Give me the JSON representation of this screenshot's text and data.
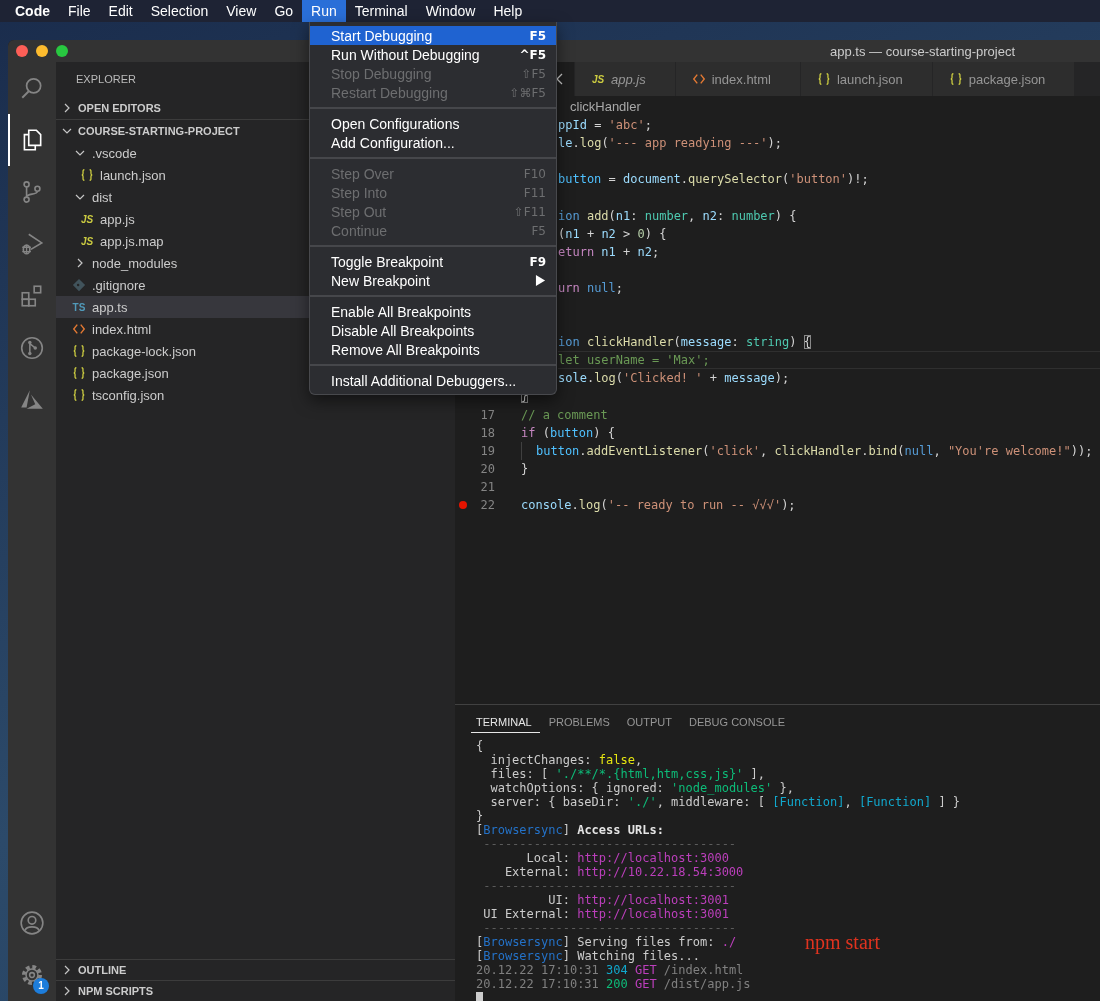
{
  "menu_bar": {
    "items": [
      {
        "label": "Code",
        "kind": "app",
        "selected": false
      },
      {
        "label": "File",
        "kind": "menu",
        "selected": false
      },
      {
        "label": "Edit",
        "kind": "menu",
        "selected": false
      },
      {
        "label": "Selection",
        "kind": "menu",
        "selected": false
      },
      {
        "label": "View",
        "kind": "menu",
        "selected": false
      },
      {
        "label": "Go",
        "kind": "menu",
        "selected": false
      },
      {
        "label": "Run",
        "kind": "menu",
        "selected": true
      },
      {
        "label": "Terminal",
        "kind": "menu",
        "selected": false
      },
      {
        "label": "Window",
        "kind": "menu",
        "selected": false
      },
      {
        "label": "Help",
        "kind": "menu",
        "selected": false
      }
    ]
  },
  "run_menu": {
    "groups": [
      [
        {
          "label": "Start Debugging",
          "shortcut": "F5",
          "disabled": false,
          "selected": true,
          "submenu": false
        },
        {
          "label": "Run Without Debugging",
          "shortcut": "^F5",
          "disabled": false,
          "selected": false,
          "submenu": false
        },
        {
          "label": "Stop Debugging",
          "shortcut": "⇧F5",
          "disabled": true,
          "selected": false,
          "submenu": false
        },
        {
          "label": "Restart Debugging",
          "shortcut": "⇧⌘F5",
          "disabled": true,
          "selected": false,
          "submenu": false
        }
      ],
      [
        {
          "label": "Open Configurations",
          "disabled": false,
          "selected": false,
          "submenu": false
        },
        {
          "label": "Add Configuration...",
          "disabled": false,
          "selected": false,
          "submenu": false
        }
      ],
      [
        {
          "label": "Step Over",
          "shortcut": "F10",
          "disabled": true,
          "selected": false,
          "submenu": false
        },
        {
          "label": "Step Into",
          "shortcut": "F11",
          "disabled": true,
          "selected": false,
          "submenu": false
        },
        {
          "label": "Step Out",
          "shortcut": "⇧F11",
          "disabled": true,
          "selected": false,
          "submenu": false
        },
        {
          "label": "Continue",
          "shortcut": "F5",
          "disabled": true,
          "selected": false,
          "submenu": false
        }
      ],
      [
        {
          "label": "Toggle Breakpoint",
          "shortcut": "F9",
          "disabled": false,
          "selected": false,
          "submenu": false
        },
        {
          "label": "New Breakpoint",
          "disabled": false,
          "selected": false,
          "submenu": true
        }
      ],
      [
        {
          "label": "Enable All Breakpoints",
          "disabled": false,
          "selected": false,
          "submenu": false
        },
        {
          "label": "Disable All Breakpoints",
          "disabled": false,
          "selected": false,
          "submenu": false
        },
        {
          "label": "Remove All Breakpoints",
          "disabled": false,
          "selected": false,
          "submenu": false
        }
      ],
      [
        {
          "label": "Install Additional Debuggers...",
          "disabled": false,
          "selected": false,
          "submenu": false
        }
      ]
    ]
  },
  "window": {
    "title": "app.ts — course-starting-project"
  },
  "activity_bar": {
    "items": [
      {
        "kind": "search",
        "selected": false
      },
      {
        "kind": "explorer",
        "selected": true
      },
      {
        "kind": "source-control",
        "selected": false
      },
      {
        "kind": "run",
        "selected": false
      },
      {
        "kind": "extensions",
        "selected": false
      },
      {
        "kind": "git-graph",
        "selected": false
      },
      {
        "kind": "azure",
        "selected": false
      }
    ],
    "bottom": [
      {
        "kind": "account"
      },
      {
        "kind": "settings",
        "badge": "1"
      }
    ]
  },
  "sidebar": {
    "title": "EXPLORER",
    "sections": [
      {
        "title": "OPEN EDITORS",
        "expanded": false
      },
      {
        "title": "COURSE-STARTING-PROJECT",
        "expanded": true,
        "children": [
          {
            "name": ".vscode",
            "kind": "folder",
            "expanded": true,
            "selected": false,
            "children": [
              {
                "name": "launch.json",
                "kind": "json",
                "selected": false
              }
            ]
          },
          {
            "name": "dist",
            "kind": "folder",
            "expanded": true,
            "selected": false,
            "children": [
              {
                "name": "app.js",
                "kind": "script",
                "icon_text": "JS",
                "selected": false
              },
              {
                "name": "app.js.map",
                "kind": "script",
                "icon_text": "JS",
                "selected": false
              }
            ]
          },
          {
            "name": "node_modules",
            "kind": "folder",
            "expanded": false,
            "selected": false
          },
          {
            "name": ".gitignore",
            "kind": "git",
            "selected": false
          },
          {
            "name": "app.ts",
            "kind": "typescript",
            "icon_text": "TS",
            "selected": true
          },
          {
            "name": "index.html",
            "kind": "html",
            "selected": false
          },
          {
            "name": "package-lock.json",
            "kind": "json",
            "selected": false
          },
          {
            "name": "package.json",
            "kind": "json",
            "selected": false
          },
          {
            "name": "tsconfig.json",
            "kind": "json",
            "selected": false
          }
        ]
      }
    ],
    "bottom_sections": [
      {
        "title": "OUTLINE",
        "expanded": false
      },
      {
        "title": "NPM SCRIPTS",
        "expanded": false
      }
    ]
  },
  "editor": {
    "tabs": [
      {
        "kind": "hidden",
        "selected": true,
        "preview": false
      },
      {
        "label": "app.js",
        "kind": "script",
        "icon_text": "JS",
        "selected": false,
        "preview": true
      },
      {
        "label": "index.html",
        "kind": "html",
        "selected": false,
        "preview": false
      },
      {
        "label": "launch.json",
        "kind": "json",
        "selected": false,
        "preview": false
      },
      {
        "label": "package.json",
        "kind": "json",
        "selected": false,
        "preview": false
      }
    ],
    "breadcrumb": {
      "symbol": "clickHandler"
    },
    "lines": [
      {
        "kind": "clipped",
        "current": false,
        "breakpoint": false,
        "indent_guide": false,
        "tokens": [
          {
            "kind": "var",
            "text": "ppId"
          },
          {
            "kind": "plain",
            "text": " = "
          },
          {
            "kind": "str",
            "text": "'abc'"
          },
          {
            "kind": "plain",
            "text": ";"
          }
        ]
      },
      {
        "kind": "clipped",
        "current": false,
        "breakpoint": false,
        "indent_guide": false,
        "tokens": [
          {
            "kind": "var",
            "text": "le"
          },
          {
            "kind": "plain",
            "text": "."
          },
          {
            "kind": "fn",
            "text": "log"
          },
          {
            "kind": "plain",
            "text": "("
          },
          {
            "kind": "str",
            "text": "'--- app readying ---'"
          },
          {
            "kind": "plain",
            "text": ");"
          }
        ]
      },
      {
        "kind": "clipped"
      },
      {
        "kind": "clipped",
        "current": false,
        "breakpoint": false,
        "indent_guide": false,
        "tokens": [
          {
            "kind": "const",
            "text": "button"
          },
          {
            "kind": "plain",
            "text": " = "
          },
          {
            "kind": "var",
            "text": "document"
          },
          {
            "kind": "plain",
            "text": "."
          },
          {
            "kind": "fn",
            "text": "querySelector"
          },
          {
            "kind": "plain",
            "text": "("
          },
          {
            "kind": "str",
            "text": "'button'"
          },
          {
            "kind": "plain",
            "text": ")!;"
          }
        ]
      },
      {
        "kind": "clipped"
      },
      {
        "kind": "clipped",
        "current": false,
        "breakpoint": false,
        "indent_guide": false,
        "tokens": [
          {
            "kind": "kw",
            "text": "ion "
          },
          {
            "kind": "fn",
            "text": "add"
          },
          {
            "kind": "plain",
            "text": "("
          },
          {
            "kind": "var",
            "text": "n1"
          },
          {
            "kind": "plain",
            "text": ": "
          },
          {
            "kind": "type",
            "text": "number"
          },
          {
            "kind": "plain",
            "text": ", "
          },
          {
            "kind": "var",
            "text": "n2"
          },
          {
            "kind": "plain",
            "text": ": "
          },
          {
            "kind": "type",
            "text": "number"
          },
          {
            "kind": "plain",
            "text": ") {"
          }
        ]
      },
      {
        "kind": "clipped",
        "current": false,
        "breakpoint": false,
        "indent_guide": false,
        "tokens": [
          {
            "kind": "plain",
            "text": "("
          },
          {
            "kind": "var",
            "text": "n1"
          },
          {
            "kind": "plain",
            "text": " + "
          },
          {
            "kind": "var",
            "text": "n2"
          },
          {
            "kind": "plain",
            "text": " > "
          },
          {
            "kind": "num",
            "text": "0"
          },
          {
            "kind": "plain",
            "text": ") {"
          }
        ]
      },
      {
        "kind": "clipped",
        "current": false,
        "breakpoint": false,
        "indent_guide": false,
        "tokens": [
          {
            "kind": "ctl",
            "text": "eturn "
          },
          {
            "kind": "var",
            "text": "n1"
          },
          {
            "kind": "plain",
            "text": " + "
          },
          {
            "kind": "var",
            "text": "n2"
          },
          {
            "kind": "plain",
            "text": ";"
          }
        ]
      },
      {
        "kind": "clipped"
      },
      {
        "kind": "clipped",
        "current": false,
        "breakpoint": false,
        "indent_guide": false,
        "tokens": [
          {
            "kind": "ctl",
            "text": "urn "
          },
          {
            "kind": "kw",
            "text": "null"
          },
          {
            "kind": "plain",
            "text": ";"
          }
        ]
      },
      {
        "kind": "clipped"
      },
      {
        "kind": "clipped"
      },
      {
        "kind": "clipped",
        "current": false,
        "breakpoint": false,
        "indent_guide": false,
        "tokens": [
          {
            "kind": "kw",
            "text": "ion "
          },
          {
            "kind": "fn",
            "text": "clickHandler"
          },
          {
            "kind": "plain",
            "text": "("
          },
          {
            "kind": "var",
            "text": "message"
          },
          {
            "kind": "plain",
            "text": ": "
          },
          {
            "kind": "type",
            "text": "string"
          },
          {
            "kind": "plain",
            "text": ") "
          },
          {
            "kind": "bracket",
            "text": "{"
          }
        ]
      },
      {
        "kind": "clipped",
        "current": true,
        "breakpoint": false,
        "indent_guide": false,
        "tokens": [
          {
            "kind": "com",
            "text": "let userName = 'Max';"
          }
        ]
      },
      {
        "kind": "clipped",
        "current": false,
        "breakpoint": false,
        "indent_guide": false,
        "tokens": [
          {
            "kind": "var",
            "text": "sole"
          },
          {
            "kind": "plain",
            "text": "."
          },
          {
            "kind": "fn",
            "text": "log"
          },
          {
            "kind": "plain",
            "text": "("
          },
          {
            "kind": "str",
            "text": "'Clicked! '"
          },
          {
            "kind": "plain",
            "text": " + "
          },
          {
            "kind": "var",
            "text": "message"
          },
          {
            "kind": "plain",
            "text": ");"
          }
        ]
      },
      {
        "kind": "full",
        "current": false,
        "breakpoint": false,
        "indent_guide": false,
        "tokens": [
          {
            "kind": "bracket",
            "text": "}"
          }
        ]
      },
      {
        "kind": "full",
        "number": "17",
        "current": false,
        "breakpoint": false,
        "indent_guide": false,
        "tokens": [
          {
            "kind": "com",
            "text": "// a comment"
          }
        ]
      },
      {
        "kind": "full",
        "number": "18",
        "current": false,
        "breakpoint": false,
        "indent_guide": false,
        "tokens": [
          {
            "kind": "ctl",
            "text": "if"
          },
          {
            "kind": "plain",
            "text": " ("
          },
          {
            "kind": "const",
            "text": "button"
          },
          {
            "kind": "plain",
            "text": ") {"
          }
        ]
      },
      {
        "kind": "full",
        "number": "19",
        "current": false,
        "breakpoint": false,
        "indent_guide": true,
        "tokens": [
          {
            "kind": "const",
            "text": "button"
          },
          {
            "kind": "plain",
            "text": "."
          },
          {
            "kind": "fn",
            "text": "addEventListener"
          },
          {
            "kind": "plain",
            "text": "("
          },
          {
            "kind": "str",
            "text": "'click'"
          },
          {
            "kind": "plain",
            "text": ", "
          },
          {
            "kind": "fn",
            "text": "clickHandler"
          },
          {
            "kind": "plain",
            "text": "."
          },
          {
            "kind": "fn",
            "text": "bind"
          },
          {
            "kind": "plain",
            "text": "("
          },
          {
            "kind": "kw",
            "text": "null"
          },
          {
            "kind": "plain",
            "text": ", "
          },
          {
            "kind": "str",
            "text": "\"You're welcome!\""
          },
          {
            "kind": "plain",
            "text": "));"
          }
        ]
      },
      {
        "kind": "full",
        "number": "20",
        "current": false,
        "breakpoint": false,
        "indent_guide": false,
        "tokens": [
          {
            "kind": "plain",
            "text": "}"
          }
        ]
      },
      {
        "kind": "full",
        "number": "21",
        "current": false,
        "breakpoint": false,
        "indent_guide": false
      },
      {
        "kind": "full",
        "number": "22",
        "current": false,
        "breakpoint": true,
        "indent_guide": false,
        "tokens": [
          {
            "kind": "var",
            "text": "console"
          },
          {
            "kind": "plain",
            "text": "."
          },
          {
            "kind": "fn",
            "text": "log"
          },
          {
            "kind": "plain",
            "text": "("
          },
          {
            "kind": "str",
            "text": "'-- ready to run -- √√√'"
          },
          {
            "kind": "plain",
            "text": ");"
          }
        ]
      }
    ]
  },
  "panel": {
    "tabs": [
      {
        "label": "TERMINAL",
        "selected": true
      },
      {
        "label": "PROBLEMS",
        "selected": false
      },
      {
        "label": "OUTPUT",
        "selected": false
      },
      {
        "label": "DEBUG CONSOLE",
        "selected": false
      }
    ],
    "terminal": {
      "cursor": true,
      "lines": [
        {
          "kind": "text",
          "tokens": [
            {
              "kind": "plain",
              "text": "{"
            }
          ]
        },
        {
          "kind": "text",
          "tokens": [
            {
              "kind": "plain",
              "text": "  injectChanges: "
            },
            {
              "kind": "bool",
              "text": "false"
            },
            {
              "kind": "plain",
              "text": ","
            }
          ]
        },
        {
          "kind": "text",
          "tokens": [
            {
              "kind": "plain",
              "text": "  files: [ "
            },
            {
              "kind": "str",
              "text": "'./**/*.{html,htm,css,js}'"
            },
            {
              "kind": "plain",
              "text": " ],"
            }
          ]
        },
        {
          "kind": "text",
          "tokens": [
            {
              "kind": "plain",
              "text": "  watchOptions: { ignored: "
            },
            {
              "kind": "str",
              "text": "'node_modules'"
            },
            {
              "kind": "plain",
              "text": " },"
            }
          ]
        },
        {
          "kind": "text",
          "tokens": [
            {
              "kind": "plain",
              "text": "  server: { baseDir: "
            },
            {
              "kind": "str",
              "text": "'./'"
            },
            {
              "kind": "plain",
              "text": ", middleware: [ "
            },
            {
              "kind": "fn",
              "text": "[Function]"
            },
            {
              "kind": "plain",
              "text": ", "
            },
            {
              "kind": "fn",
              "text": "[Function]"
            },
            {
              "kind": "plain",
              "text": " ] }"
            }
          ]
        },
        {
          "kind": "text",
          "tokens": [
            {
              "kind": "plain",
              "text": "}"
            }
          ]
        },
        {
          "kind": "text",
          "tokens": [
            {
              "kind": "plain",
              "text": "["
            },
            {
              "kind": "tag",
              "text": "Browsersync"
            },
            {
              "kind": "plain",
              "text": "] "
            },
            {
              "kind": "bold",
              "text": "Access URLs:"
            }
          ]
        },
        {
          "kind": "rule",
          "tokens": [
            {
              "kind": "rule",
              "text": " -----------------------------------"
            }
          ]
        },
        {
          "kind": "text",
          "tokens": [
            {
              "kind": "plain",
              "text": "       Local: "
            },
            {
              "kind": "url",
              "text": "http://localhost:3000"
            }
          ]
        },
        {
          "kind": "text",
          "tokens": [
            {
              "kind": "plain",
              "text": "    External: "
            },
            {
              "kind": "url",
              "text": "http://10.22.18.54:3000"
            }
          ]
        },
        {
          "kind": "rule",
          "tokens": [
            {
              "kind": "rule",
              "text": " -----------------------------------"
            }
          ]
        },
        {
          "kind": "text",
          "tokens": [
            {
              "kind": "plain",
              "text": "          UI: "
            },
            {
              "kind": "url",
              "text": "http://localhost:3001"
            }
          ]
        },
        {
          "kind": "text",
          "tokens": [
            {
              "kind": "plain",
              "text": " UI External: "
            },
            {
              "kind": "url",
              "text": "http://localhost:3001"
            }
          ]
        },
        {
          "kind": "rule",
          "tokens": [
            {
              "kind": "rule",
              "text": " -----------------------------------"
            }
          ]
        },
        {
          "kind": "text",
          "tokens": [
            {
              "kind": "plain",
              "text": "["
            },
            {
              "kind": "tag",
              "text": "Browsersync"
            },
            {
              "kind": "plain",
              "text": "] Serving files from: "
            },
            {
              "kind": "url",
              "text": "./"
            }
          ]
        },
        {
          "kind": "text",
          "tokens": [
            {
              "kind": "plain",
              "text": "["
            },
            {
              "kind": "tag",
              "text": "Browsersync"
            },
            {
              "kind": "plain",
              "text": "] Watching files..."
            }
          ]
        },
        {
          "kind": "text",
          "tokens": [
            {
              "kind": "dim",
              "text": "20.12.22 17:10:31 "
            },
            {
              "kind": "info",
              "text": "304"
            },
            {
              "kind": "url",
              "text": " GET"
            },
            {
              "kind": "dim",
              "text": " /index.html"
            }
          ]
        },
        {
          "kind": "text",
          "tokens": [
            {
              "kind": "dim",
              "text": "20.12.22 17:10:31 "
            },
            {
              "kind": "ok",
              "text": "200"
            },
            {
              "kind": "url",
              "text": " GET"
            },
            {
              "kind": "dim",
              "text": " /dist/app.js"
            }
          ]
        }
      ]
    },
    "annotation": "npm start"
  }
}
